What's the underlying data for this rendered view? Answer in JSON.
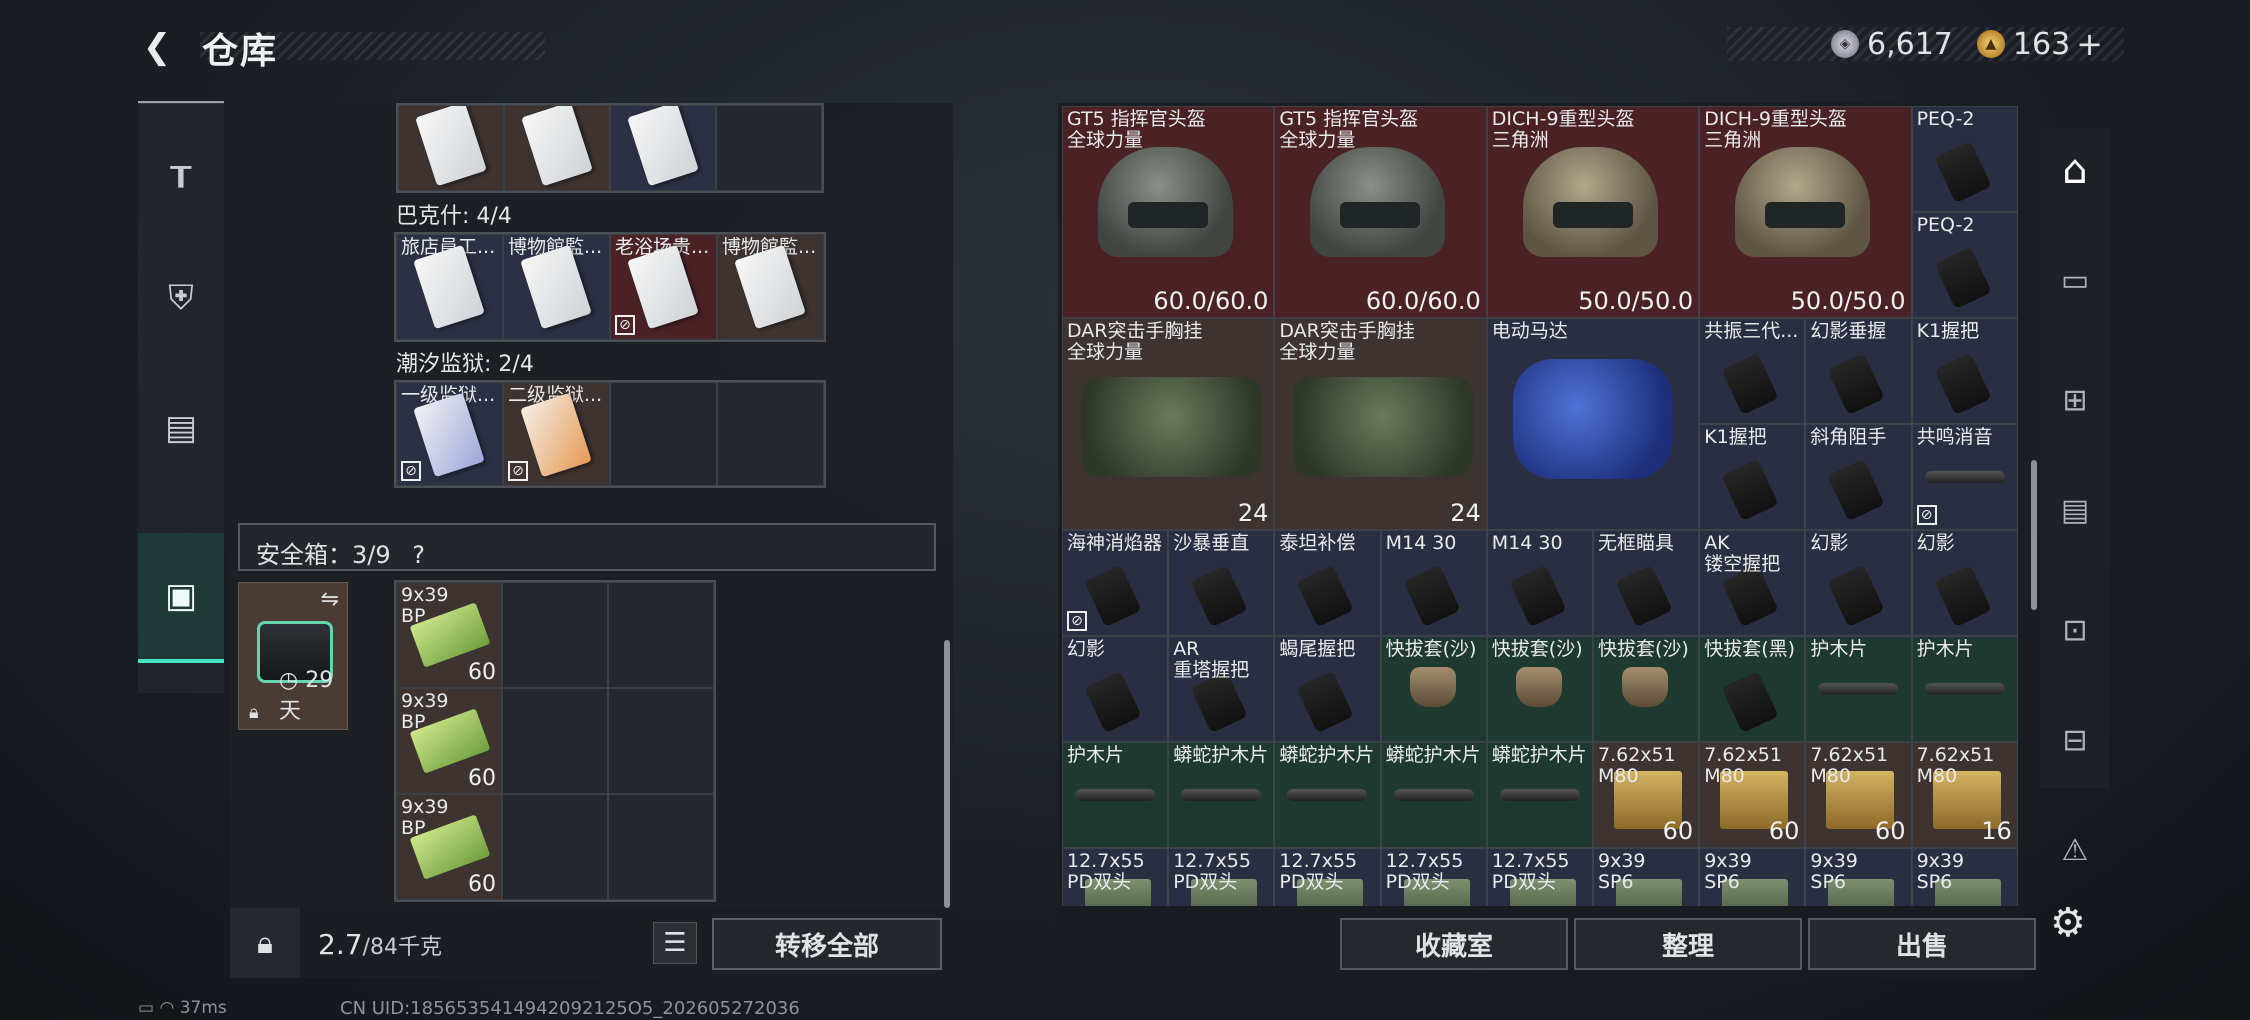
{
  "header": {
    "title": "仓库",
    "silver": "6,617",
    "gold": "163",
    "plus": "+"
  },
  "left": {
    "top_row": [
      {
        "label": ""
      },
      {
        "label": ""
      },
      {
        "label": ""
      },
      {
        "label": ""
      }
    ],
    "bakesh_label": "巴克什: 4/4",
    "bakesh_items": [
      "旅店員工...",
      "博物館監...",
      "老浴场贵...",
      "博物館監..."
    ],
    "chaoxi_label": "潮汐监狱: 2/4",
    "chaoxi_items": [
      "一级监狱...",
      "二级监狱..."
    ],
    "safe_label": "安全箱：3/9",
    "safe_help": "?",
    "safe_days": "29天",
    "ammo": [
      {
        "label": "9x39\nBP",
        "count": "60"
      },
      {
        "label": "9x39\nBP",
        "count": "60"
      },
      {
        "label": "9x39\nBP",
        "count": "60"
      }
    ],
    "weight_value": "2.7",
    "weight_max": "/84千克",
    "move_all": "转移全部"
  },
  "right": {
    "items": [
      {
        "id": "gt5a",
        "label": "GT5 指挥官头盔\n全球力量",
        "count": "60.0/60.0"
      },
      {
        "id": "gt5b",
        "label": "GT5 指挥官头盔\n全球力量",
        "count": "60.0/60.0"
      },
      {
        "id": "dich1",
        "label": "DICH-9重型头盔\n三角洲",
        "count": "50.0/50.0"
      },
      {
        "id": "dich2",
        "label": "DICH-9重型头盔\n三角洲",
        "count": "50.0/50.0"
      },
      {
        "id": "peq1",
        "label": "PEQ-2",
        "count": ""
      },
      {
        "id": "peq2",
        "label": "PEQ-2",
        "count": ""
      },
      {
        "id": "dar1",
        "label": "DAR突击手胸挂\n全球力量",
        "count": "24"
      },
      {
        "id": "dar2",
        "label": "DAR突击手胸挂\n全球力量",
        "count": "24"
      },
      {
        "id": "motor",
        "label": "电动马达",
        "count": ""
      },
      {
        "id": "gz",
        "label": "共振三代...",
        "count": ""
      },
      {
        "id": "hyc",
        "label": "幻影垂握",
        "count": ""
      },
      {
        "id": "k1a",
        "label": "K1握把",
        "count": ""
      },
      {
        "id": "k1b",
        "label": "K1握把",
        "count": ""
      },
      {
        "id": "xj",
        "label": "斜角阻手",
        "count": ""
      },
      {
        "id": "gm",
        "label": "共鸣消音",
        "count": ""
      },
      {
        "id": "hs",
        "label": "海神消焰器",
        "count": ""
      },
      {
        "id": "sb",
        "label": "沙暴垂直",
        "count": ""
      },
      {
        "id": "tt",
        "label": "泰坦补偿",
        "count": ""
      },
      {
        "id": "m14a",
        "label": "M14 30",
        "count": ""
      },
      {
        "id": "m14b",
        "label": "M14 30",
        "count": ""
      },
      {
        "id": "wk",
        "label": "无框瞄具",
        "count": ""
      },
      {
        "id": "ak",
        "label": "AK\n镂空握把",
        "count": ""
      },
      {
        "id": "hy1",
        "label": "幻影",
        "count": ""
      },
      {
        "id": "hy2",
        "label": "幻影",
        "count": ""
      },
      {
        "id": "hy3",
        "label": "幻影",
        "count": ""
      },
      {
        "id": "ar",
        "label": "AR\n重塔握把",
        "count": ""
      },
      {
        "id": "xw",
        "label": "蝎尾握把",
        "count": ""
      },
      {
        "id": "kb1",
        "label": "快拔套(沙)",
        "count": ""
      },
      {
        "id": "kb2",
        "label": "快拔套(沙)",
        "count": ""
      },
      {
        "id": "kb3",
        "label": "快拔套(沙)",
        "count": ""
      },
      {
        "id": "kb4",
        "label": "快拔套(黑)",
        "count": ""
      },
      {
        "id": "hm1",
        "label": "护木片",
        "count": ""
      },
      {
        "id": "hm2",
        "label": "护木片",
        "count": ""
      },
      {
        "id": "hm3",
        "label": "护木片",
        "count": ""
      },
      {
        "id": "ms1",
        "label": "蟒蛇护木片",
        "count": ""
      },
      {
        "id": "ms2",
        "label": "蟒蛇护木片",
        "count": ""
      },
      {
        "id": "ms3",
        "label": "蟒蛇护木片",
        "count": ""
      },
      {
        "id": "ms4",
        "label": "蟒蛇护木片",
        "count": ""
      },
      {
        "id": "a1",
        "label": "7.62x51\nM80",
        "count": "60"
      },
      {
        "id": "a2",
        "label": "7.62x51\nM80",
        "count": "60"
      },
      {
        "id": "a3",
        "label": "7.62x51\nM80",
        "count": "60"
      },
      {
        "id": "a4",
        "label": "7.62x51\nM80",
        "count": "16"
      },
      {
        "id": "b1",
        "label": "12.7x55\nPD双头",
        "count": ""
      },
      {
        "id": "b2",
        "label": "12.7x55\nPD双头",
        "count": ""
      },
      {
        "id": "b3",
        "label": "12.7x55\nPD双头",
        "count": ""
      },
      {
        "id": "b4",
        "label": "12.7x55\nPD双头",
        "count": ""
      },
      {
        "id": "b5",
        "label": "12.7x55\nPD双头",
        "count": ""
      },
      {
        "id": "c1",
        "label": "9x39\nSP6",
        "count": ""
      },
      {
        "id": "c2",
        "label": "9x39\nSP6",
        "count": ""
      },
      {
        "id": "c3",
        "label": "9x39\nSP6",
        "count": ""
      },
      {
        "id": "c4",
        "label": "9x39\nSP6",
        "count": ""
      }
    ],
    "btn_collection": "收藏室",
    "btn_sort": "整理",
    "btn_sell": "出售"
  },
  "status": {
    "ping": "37ms",
    "uid": "CN UID:1856535414942092125O5_202605272036"
  }
}
